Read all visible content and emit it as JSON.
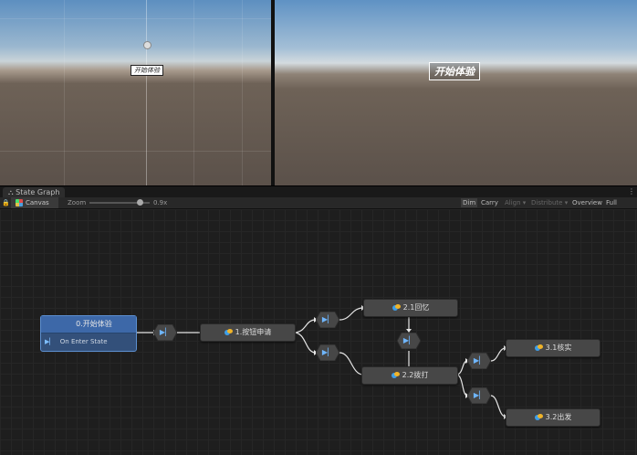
{
  "scene_view": {
    "label": "开始体验"
  },
  "game_view": {
    "label": "开始体验"
  },
  "editor_tab": {
    "title": "State Graph",
    "menu": "⋮"
  },
  "toolbar": {
    "breadcrumb": "Canvas",
    "zoom_label": "Zoom",
    "zoom_value": "0.9x",
    "buttons": [
      "Dim",
      "Carry",
      "Align",
      "Distribute",
      "Overview",
      "Full Screen"
    ]
  },
  "graph": {
    "start_node": {
      "title": "0.开始体验",
      "event": "On Enter State"
    },
    "nodes": {
      "n1": "1.按钮申请",
      "n21": "2.1回忆",
      "n22": "2.2拨打",
      "n31": "3.1核实",
      "n32": "3.2出发"
    }
  },
  "colors": {
    "accent": "#3d68a8",
    "node": "#474747",
    "transition_icon": "#6fb6ff"
  }
}
